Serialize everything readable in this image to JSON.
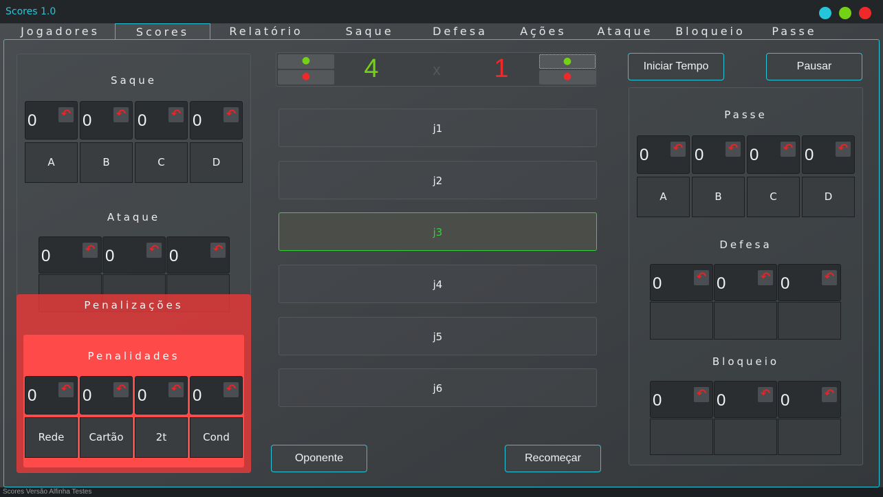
{
  "window": {
    "title": "Scores 1.0",
    "controls": {
      "c1": "#26c6da",
      "c2": "#73d216",
      "c3": "#ef2929"
    }
  },
  "tabs": [
    {
      "label": "Jogadores"
    },
    {
      "label": "Scores",
      "active": true
    },
    {
      "label": "Relatório"
    },
    {
      "label": "Saque"
    },
    {
      "label": "Defesa"
    },
    {
      "label": "Ações"
    },
    {
      "label": "Ataque"
    },
    {
      "label": "Bloqueio"
    },
    {
      "label": "Passe"
    }
  ],
  "left": {
    "saque": {
      "title": "Saque",
      "values": [
        "0",
        "0",
        "0",
        "0"
      ],
      "labels": [
        "A",
        "B",
        "C",
        "D"
      ]
    },
    "ataque": {
      "title": "Ataque",
      "values": [
        "0",
        "0",
        "0"
      ]
    },
    "penalizacoes": {
      "title": "Penalizações"
    },
    "penalidades": {
      "title": "Penalidades",
      "values": [
        "0",
        "0",
        "0",
        "0"
      ],
      "labels": [
        "Rede",
        "Cartão",
        "2t",
        "Cond"
      ]
    }
  },
  "center": {
    "score": {
      "home": "4",
      "sep": "x",
      "away": "1",
      "home_color": "#73d216",
      "away_color": "#ef2929"
    },
    "players": [
      "j1",
      "j2",
      "j3",
      "j4",
      "j5",
      "j6"
    ],
    "selected_player": "j3",
    "opponent_button": "Oponente",
    "restart_button": "Recomeçar"
  },
  "right": {
    "start_button": "Iniciar Tempo",
    "pause_button": "Pausar",
    "passe": {
      "title": "Passe",
      "values": [
        "0",
        "0",
        "0",
        "0"
      ],
      "labels": [
        "A",
        "B",
        "C",
        "D"
      ]
    },
    "defesa": {
      "title": "Defesa",
      "values": [
        "0",
        "0",
        "0"
      ]
    },
    "bloqueio": {
      "title": "Bloqueio",
      "values": [
        "0",
        "0",
        "0"
      ]
    }
  },
  "status": {
    "text": "Scores Versão Alfinha Testes"
  },
  "icons": {
    "undo": "undo-icon"
  }
}
